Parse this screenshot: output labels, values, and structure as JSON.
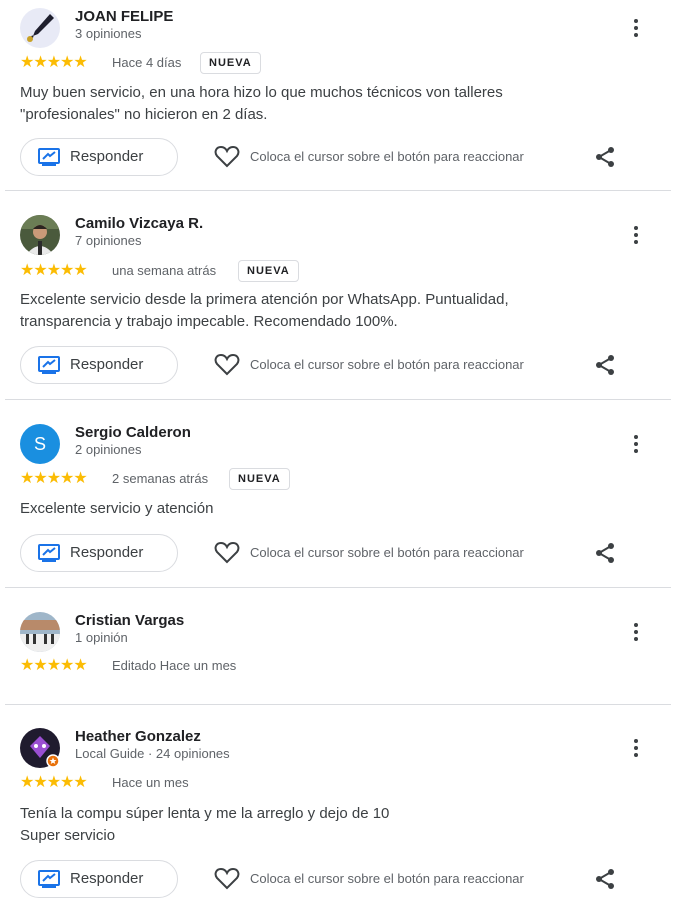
{
  "ui": {
    "reply_label": "Responder",
    "react_hint": "Coloca el cursor sobre el botón para reaccionar",
    "new_badge": "NUEVA"
  },
  "reviews": [
    {
      "name": "JOAN FELIPE",
      "subtitle": "3 opiniones",
      "stars": "★★★★★",
      "rating": 5,
      "time": "Hace 4 días",
      "text": "Muy buen servicio, en una hora hizo lo que muchos técnicos von talleres\n\"profesionales\" no hicieron en 2 días.",
      "avatar_icon": "pen-photo-avatar"
    },
    {
      "name": "Camilo Vizcaya R.",
      "subtitle": "7 opiniones",
      "stars": "★★★★★",
      "rating": 5,
      "time": "una semana atrás",
      "text": "Excelente servicio desde la primera atención por WhatsApp. Puntualidad,\ntransparencia y trabajo impecable. Recomendado 100%.",
      "avatar_icon": "person-photo-avatar"
    },
    {
      "name": "Sergio Calderon",
      "subtitle": "2 opiniones",
      "stars": "★★★★★",
      "rating": 5,
      "time": "2 semanas atrás",
      "text": "Excelente servicio y atención",
      "avatar_letter": "S",
      "avatar_color": "#1a8fe0"
    },
    {
      "name": "Cristian Vargas",
      "subtitle": "1 opinión",
      "stars": "★★★★★",
      "rating": 5,
      "time": "Editado Hace un mes",
      "avatar_icon": "piano-photo-avatar"
    },
    {
      "name": "Heather Gonzalez",
      "subtitle": "Local Guide · 24 opiniones",
      "stars": "★★★★★",
      "rating": 5,
      "time": "Hace un mes",
      "text": "Tenía la compu súper lenta y me la arreglo y dejo de 10\nSuper servicio",
      "avatar_icon": "purple-character-avatar"
    }
  ],
  "colors": {
    "star": "#fbbc04",
    "accent": "#1a73e8",
    "text": "#3c4043",
    "muted": "#5f6368",
    "divider": "#dadce0"
  }
}
